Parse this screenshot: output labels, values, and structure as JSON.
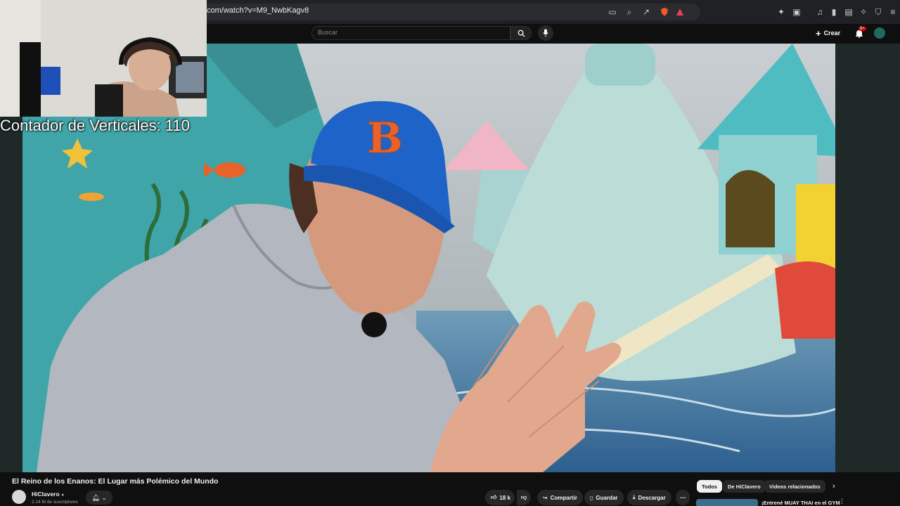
{
  "browser": {
    "url": "com/watch?v=M9_NwbKagv8"
  },
  "header": {
    "search_placeholder": "Buscar",
    "create_label": "Crear",
    "notif_count": "9+"
  },
  "overlay": {
    "counter_text": "Contador de Verticales: 110"
  },
  "video": {
    "title": "El Reino de los Enanos: El Lugar más Polémico del Mundo",
    "channel_name": "HiClavero",
    "subscribers": "2.14 M de suscriptores",
    "like_count": "18 k",
    "share_label": "Compartir",
    "save_label": "Guardar",
    "download_label": "Descargar"
  },
  "related": {
    "chips": [
      "Todos",
      "De HiClavero",
      "Videos relacionados"
    ],
    "first_title": "¡Entrené MUAY THAI en el GYM"
  }
}
